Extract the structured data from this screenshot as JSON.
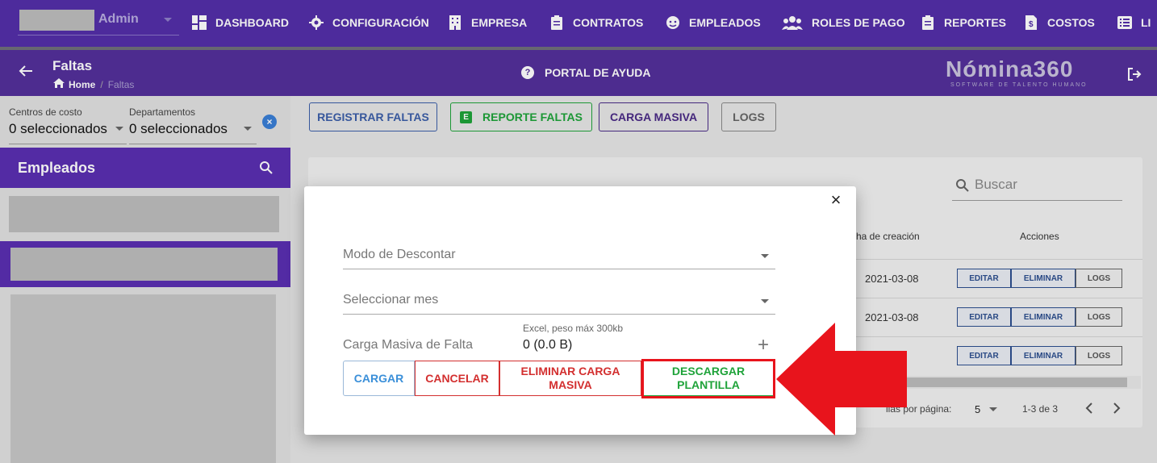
{
  "topbar": {
    "user_name": "Admin",
    "nav": [
      {
        "label": "DASHBOARD",
        "icon": "dashboard-icon"
      },
      {
        "label": "CONFIGURACIÓN",
        "icon": "gear-icon"
      },
      {
        "label": "EMPRESA",
        "icon": "building-icon"
      },
      {
        "label": "CONTRATOS",
        "icon": "clipboard-icon"
      },
      {
        "label": "EMPLEADOS",
        "icon": "face-icon"
      },
      {
        "label": "ROLES DE PAGO",
        "icon": "group-icon"
      },
      {
        "label": "REPORTES",
        "icon": "clipboard-icon"
      },
      {
        "label": "COSTOS",
        "icon": "invoice-icon"
      },
      {
        "label": "LI",
        "icon": "list-icon"
      }
    ]
  },
  "header": {
    "title": "Faltas",
    "breadcrumb": {
      "home": "Home",
      "current": "Faltas"
    },
    "help": "PORTAL DE AYUDA",
    "brand": "Nómina360",
    "brand_sub": "SOFTWARE DE TALENTO HUMANO"
  },
  "filters": {
    "cost_centers": {
      "label": "Centros de costo",
      "value": "0 seleccionados"
    },
    "departments": {
      "label": "Departamentos",
      "value": "0 seleccionados"
    }
  },
  "employees": {
    "title": "Empleados"
  },
  "toolbar": {
    "registrar": "REGISTRAR FALTAS",
    "reporte": "REPORTE FALTAS",
    "reporte_badge": "E",
    "carga": "CARGA MASIVA",
    "logs": "LOGS"
  },
  "table": {
    "search_placeholder": "Buscar",
    "columns": {
      "fecha": "ha de creación",
      "acciones": "Acciones"
    },
    "rows": [
      {
        "fecha": "2021-03-08"
      },
      {
        "fecha": "2021-03-08"
      },
      {
        "fecha": "08"
      }
    ],
    "actions": {
      "editar": "EDITAR",
      "eliminar": "ELIMINAR",
      "logs": "LOGS"
    },
    "pager": {
      "rows_label": "ilas por página:",
      "rows_value": "5",
      "range": "1-3 de 3"
    }
  },
  "modal": {
    "modo": "Modo de Descontar",
    "mes": "Seleccionar mes",
    "file_hint": "Excel, peso máx 300kb",
    "file_label": "Carga Masiva de Falta",
    "file_value": "0 (0.0 B)",
    "buttons": {
      "cargar": "CARGAR",
      "cancelar": "CANCELAR",
      "eliminar": "ELIMINAR CARGA MASIVA",
      "descargar": "DESCARGAR PLANTILLA"
    }
  },
  "colors": {
    "nav_purple": "#532fa8",
    "accent_blue": "#2d4f8f",
    "green": "#1fa33a",
    "red": "#d32f2f",
    "annotation_red": "#e8141c"
  }
}
